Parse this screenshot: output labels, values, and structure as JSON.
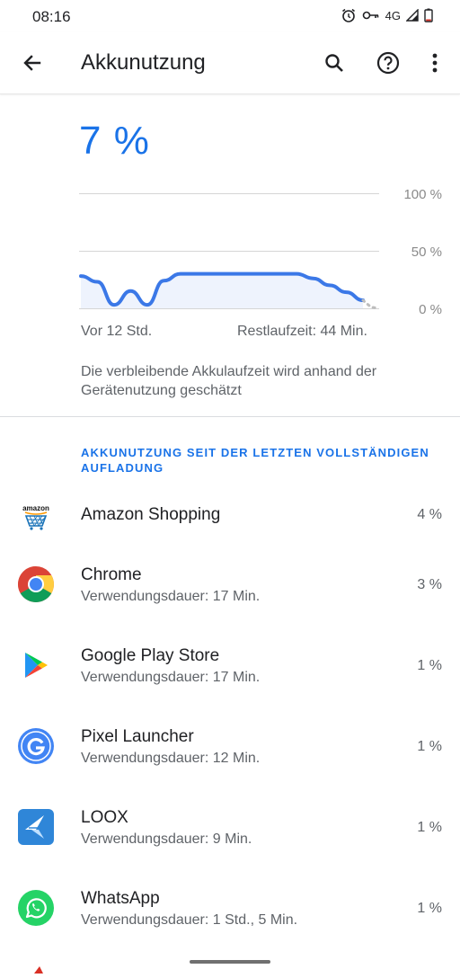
{
  "status": {
    "time": "08:16",
    "network": "4G"
  },
  "appbar": {
    "title": "Akkunutzung"
  },
  "battery": {
    "percent_label": "7 %"
  },
  "chart_data": {
    "type": "line",
    "y_labels": [
      "100 %",
      "50 %",
      "0 %"
    ],
    "ylim": [
      0,
      100
    ],
    "x_start_label": "Vor 12 Std.",
    "x_end_label": "Restlaufzeit: 44 Min.",
    "series": [
      {
        "values": [
          28,
          23,
          3,
          15,
          3,
          24,
          30,
          30,
          30,
          30,
          30,
          30,
          30,
          30,
          26,
          20,
          14,
          7
        ]
      }
    ],
    "projection": [
      7,
      1,
      0
    ],
    "colors": {
      "line": "#3b78e7",
      "fill": "#eef3fd",
      "projection": "#bdbdbd"
    }
  },
  "estimate_note": "Die verbleibende Akkulaufzeit wird anhand der Gerätenutzung geschätzt",
  "section_title": "AKKUNUTZUNG SEIT DER LETZTEN VOLLSTÄNDIGEN AUFLADUNG",
  "apps": [
    {
      "name": "Amazon Shopping",
      "usage": "",
      "percent": "4 %",
      "icon": "amazon-icon"
    },
    {
      "name": "Chrome",
      "usage": "Verwendungsdauer: 17 Min.",
      "percent": "3 %",
      "icon": "chrome-icon"
    },
    {
      "name": "Google Play Store",
      "usage": "Verwendungsdauer: 17 Min.",
      "percent": "1 %",
      "icon": "play-store-icon"
    },
    {
      "name": "Pixel Launcher",
      "usage": "Verwendungsdauer: 12 Min.",
      "percent": "1 %",
      "icon": "google-g-icon"
    },
    {
      "name": "LOOX",
      "usage": "Verwendungsdauer: 9 Min.",
      "percent": "1 %",
      "icon": "loox-icon"
    },
    {
      "name": "WhatsApp",
      "usage": "Verwendungsdauer: 1 Std., 5 Min.",
      "percent": "1 %",
      "icon": "whatsapp-icon"
    }
  ]
}
